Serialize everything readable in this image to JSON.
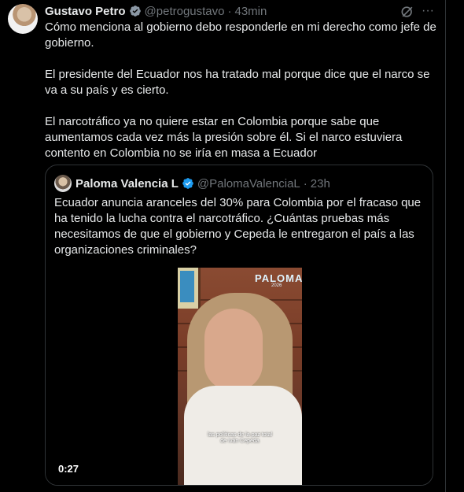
{
  "tweet": {
    "author_name": "Gustavo Petro",
    "handle": "@petrogustavo",
    "time": "43min",
    "paragraphs": [
      "Cómo menciona al gobierno debo  responderle en mi derecho como jefe de gobierno.",
      "El presidente del Ecuador nos ha tratado mal porque dice que el narco se va a su país y es cierto.",
      "El narcotráfico ya no quiere estar en Colombia porque sabe que aumentamos cada vez más la presión sobre él. Si el narco estuviera contento en Colombia no se iría en masa a Ecuador"
    ]
  },
  "quote": {
    "author_name": "Paloma Valencia L",
    "handle": "@PalomaValenciaL",
    "time": "23h",
    "text": "Ecuador anuncia aranceles del 30% para Colombia por el fracaso que ha tenido la lucha contra el narcotráfico.  ¿Cuántas pruebas más necesitamos de que el gobierno y Cepeda le entregaron el país a las organizaciones criminales?",
    "video": {
      "duration": "0:27",
      "brand": "PALOMA",
      "brand_sub": "2026",
      "caption": "las políticas de la paz total de Iván Cepeda"
    }
  },
  "icons": {
    "verified": "verified-badge-icon",
    "grok": "grok-icon",
    "more": "more-icon"
  },
  "colors": {
    "background": "#000000",
    "text": "#e7e9ea",
    "muted": "#71767b",
    "border": "#2f3336",
    "verified": "#1d9bf0"
  }
}
